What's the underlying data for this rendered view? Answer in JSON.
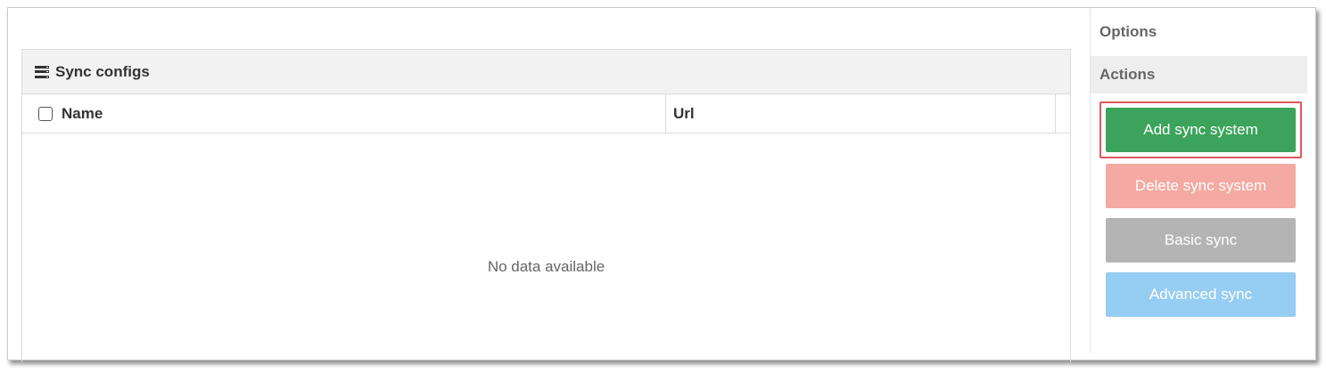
{
  "panel": {
    "title": "Sync configs",
    "icon": "server-list-icon",
    "columns": [
      "Name",
      "Url"
    ],
    "empty_text": "No data available"
  },
  "sidebar": {
    "options_label": "Options",
    "actions_label": "Actions",
    "buttons": {
      "add": "Add sync system",
      "delete": "Delete sync system",
      "basic": "Basic sync",
      "advanced": "Advanced sync"
    }
  },
  "colors": {
    "add": "#3ba35b",
    "delete": "#f4aaa2",
    "basic": "#b4b4b4",
    "advanced": "#96cdf2",
    "highlight": "#e0575a"
  }
}
